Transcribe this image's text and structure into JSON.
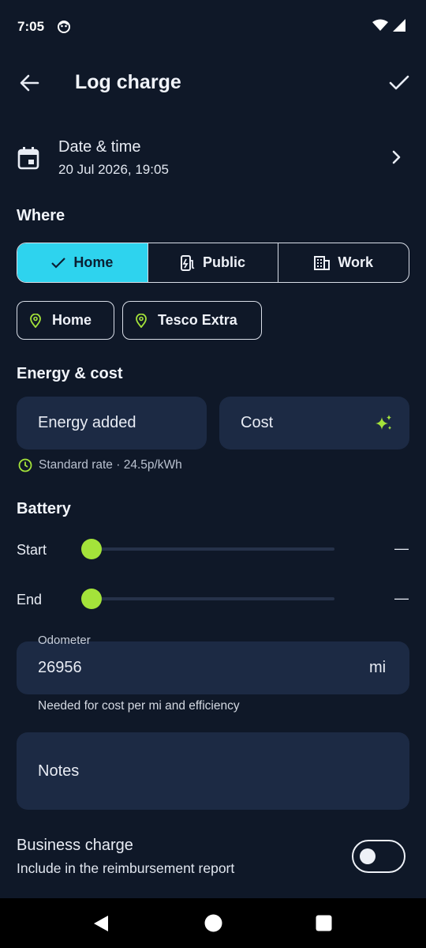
{
  "status": {
    "time": "7:05"
  },
  "toolbar": {
    "title": "Log charge"
  },
  "date_row": {
    "label": "Date & time",
    "value": "20 Jul 2026, 19:05"
  },
  "where": {
    "heading": "Where",
    "segments": [
      {
        "label": "Home",
        "selected": true
      },
      {
        "label": "Public",
        "selected": false
      },
      {
        "label": "Work",
        "selected": false
      }
    ],
    "chips": [
      "Home",
      "Tesco Extra"
    ]
  },
  "energy": {
    "heading": "Energy & cost",
    "energy_placeholder": "Energy added",
    "cost_placeholder": "Cost",
    "rate_note": "Standard rate · 24.5p/kWh"
  },
  "battery": {
    "heading": "Battery",
    "start_label": "Start",
    "end_label": "End",
    "start_value": "—",
    "end_value": "—"
  },
  "odometer": {
    "label": "Odometer",
    "value": "26956",
    "unit": "mi",
    "helper": "Needed for cost per mi and efficiency"
  },
  "notes": {
    "placeholder": "Notes"
  },
  "business": {
    "title": "Business charge",
    "subtitle": "Include in the reimbursement report",
    "enabled": false
  },
  "colors": {
    "accent": "#2ed3ee",
    "green": "#a4e33a",
    "background": "#0f1828",
    "field": "#1c2a44"
  }
}
